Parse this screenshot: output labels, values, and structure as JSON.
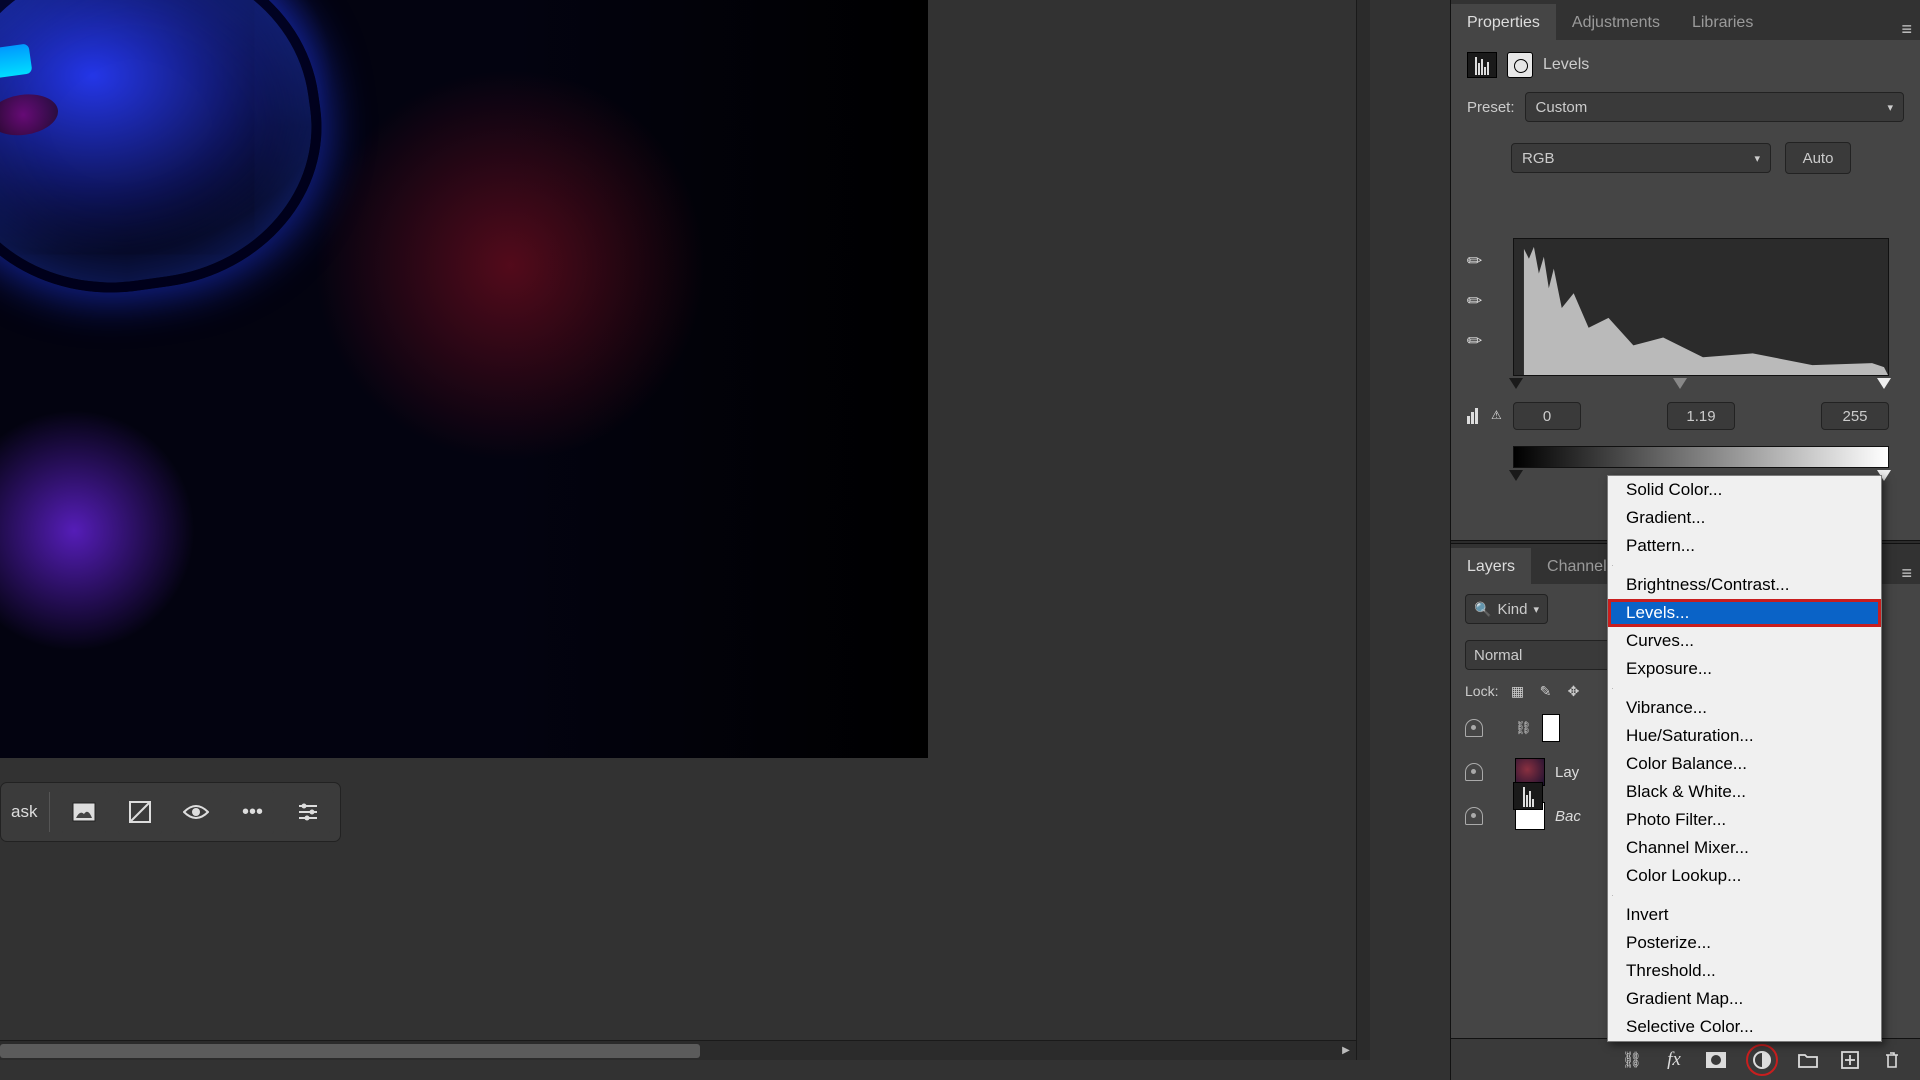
{
  "panels": {
    "tabs": {
      "properties": "Properties",
      "adjustments": "Adjustments",
      "libraries": "Libraries"
    },
    "layers_tabs": {
      "layers": "Layers",
      "channels": "Channels"
    }
  },
  "properties": {
    "adj_label": "Levels",
    "preset_label": "Preset:",
    "preset_value": "Custom",
    "channel_value": "RGB",
    "auto_label": "Auto",
    "shadows": "0",
    "mid": "1.19",
    "highlights": "255"
  },
  "layers": {
    "kind_label": "Kind",
    "blend_label": "Normal",
    "lock_label": "Lock:",
    "row1_prefix": "Lay",
    "row2_prefix": "Bac"
  },
  "toolbar": {
    "mask_label": "ask"
  },
  "ctx_menu": {
    "items_a": [
      "Solid Color...",
      "Gradient...",
      "Pattern..."
    ],
    "items_b": [
      "Brightness/Contrast...",
      "Levels...",
      "Curves...",
      "Exposure..."
    ],
    "items_c": [
      "Vibrance...",
      "Hue/Saturation...",
      "Color Balance...",
      "Black & White...",
      "Photo Filter...",
      "Channel Mixer...",
      "Color Lookup..."
    ],
    "items_d": [
      "Invert",
      "Posterize...",
      "Threshold...",
      "Gradient Map...",
      "Selective Color..."
    ],
    "selected": "Levels..."
  }
}
